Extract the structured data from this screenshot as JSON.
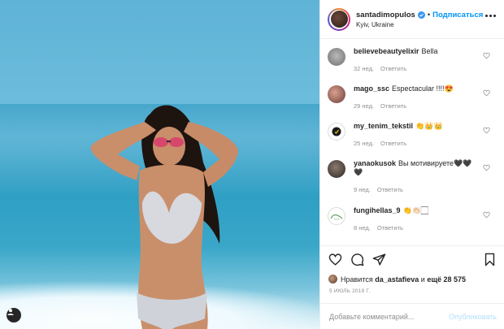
{
  "post": {
    "username": "santadimopulos",
    "follow_label": "Подписаться",
    "separator": "•",
    "location": "Kyiv, Ukraine"
  },
  "comments": [
    {
      "user": "believebeautyelixir",
      "text": "Bella",
      "age": "32 нед.",
      "reply": "Ответить"
    },
    {
      "user": "mago_ssc",
      "text": "Espectacular !!!!😍",
      "age": "29 нед.",
      "reply": "Ответить"
    },
    {
      "user": "my_tenim_tekstil",
      "text": "👏👑👑",
      "age": "25 нед.",
      "reply": "Ответить"
    },
    {
      "user": "yanaokusok",
      "text": "Вы мотивируете🖤🖤🖤",
      "age": "9 нед.",
      "reply": "Ответить"
    },
    {
      "user": "fungihellas_9",
      "text": "👏👏🏻🏻",
      "age": "8 нед.",
      "reply": "Ответить"
    }
  ],
  "likes": {
    "prefix": "Нравится",
    "user": "da_astafieva",
    "middle": "и",
    "rest": "ещё 28 575"
  },
  "date": "5 ИЮЛЬ 2019 Г.",
  "add_comment": {
    "placeholder": "Добавьте комментарий...",
    "publish_label": "Опубликовать"
  },
  "colors": {
    "accent": "#0095f6",
    "publish_disabled": "#b2dffc",
    "muted": "#8e8e8e"
  },
  "icons": [
    "verified-badge-icon",
    "more-options-icon",
    "heart-icon",
    "comment-icon",
    "share-icon",
    "bookmark-icon",
    "user-profile-icon"
  ]
}
